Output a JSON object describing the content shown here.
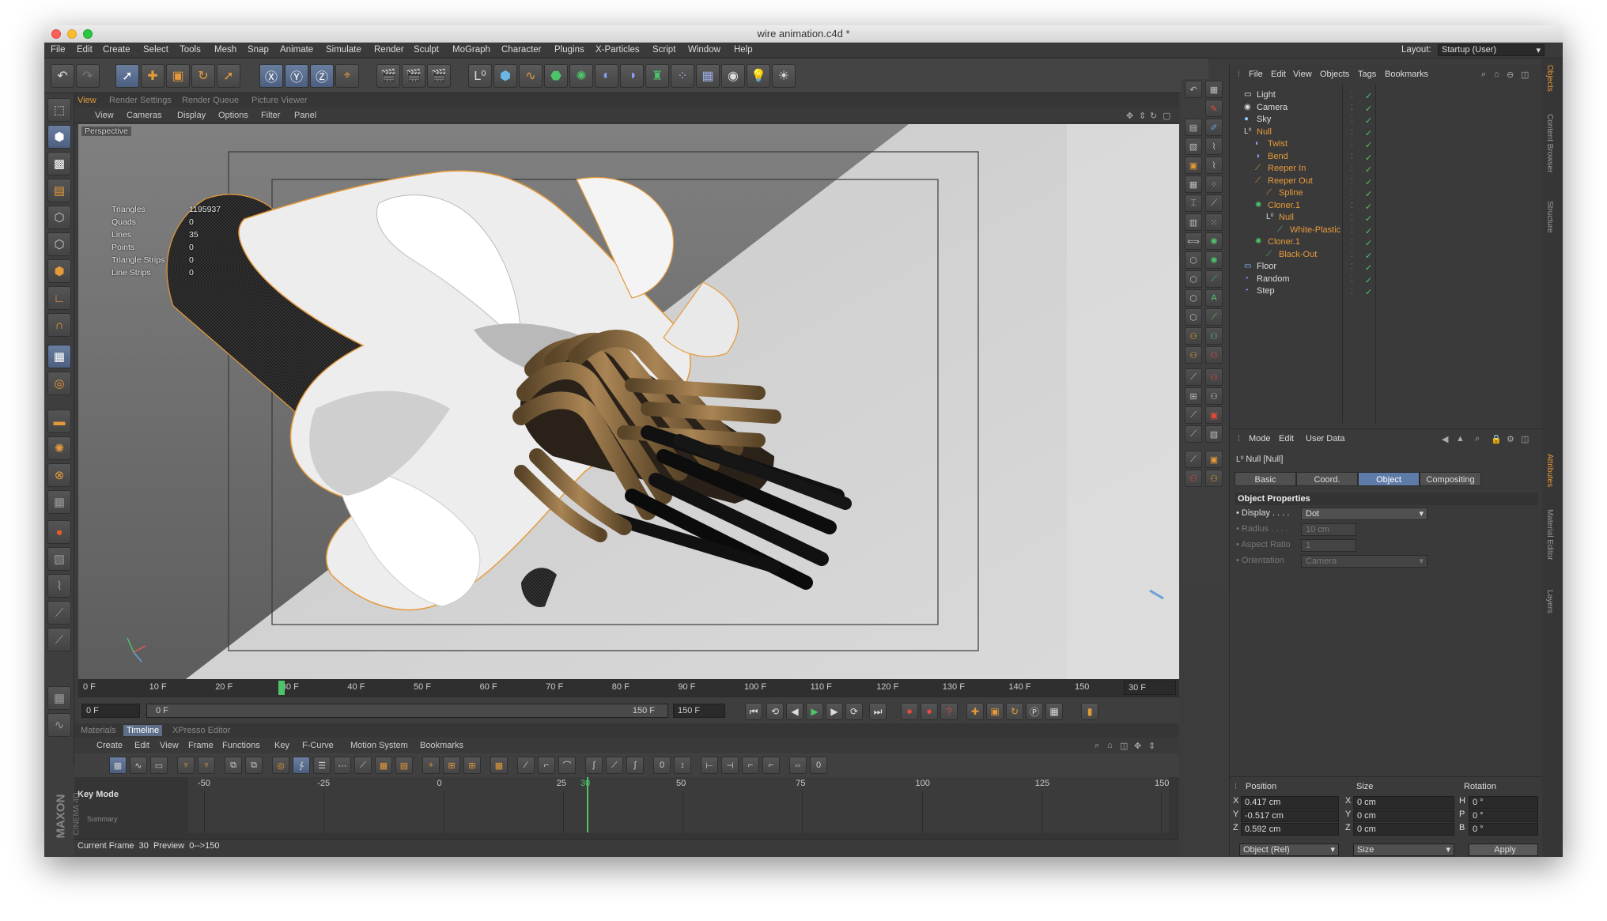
{
  "window": {
    "title": "wire animation.c4d *"
  },
  "menubar": {
    "items": [
      "File",
      "Edit",
      "Create",
      "Select",
      "Tools",
      "Mesh",
      "Snap",
      "Animate",
      "Simulate",
      "Render",
      "Sculpt",
      "MoGraph",
      "Character",
      "Plugins",
      "X-Particles",
      "Script",
      "Window",
      "Help"
    ],
    "layout_label": "Layout:",
    "layout_value": "Startup (User)"
  },
  "viewport": {
    "tabs": [
      "View",
      "Render Settings",
      "Render Queue",
      "Picture Viewer"
    ],
    "menu": [
      "View",
      "Cameras",
      "Display",
      "Options",
      "Filter",
      "Panel"
    ],
    "camera_label": "Perspective",
    "stats": [
      {
        "label": "Triangles",
        "value": "1195937"
      },
      {
        "label": "Quads",
        "value": "0"
      },
      {
        "label": "Lines",
        "value": "35"
      },
      {
        "label": "Points",
        "value": "0"
      },
      {
        "label": "Triangle Strips",
        "value": "0"
      },
      {
        "label": "Line Strips",
        "value": "0"
      }
    ],
    "colors": {
      "selection": "#e59a3a",
      "background": "#6f6f6f"
    }
  },
  "timeline_ruler": {
    "labels": [
      "0 F",
      "10 F",
      "20 F",
      "30 F",
      "40 F",
      "50 F",
      "60 F",
      "70 F",
      "80 F",
      "90 F",
      "100 F",
      "110 F",
      "120 F",
      "130 F",
      "140 F",
      "150"
    ],
    "current_frame_field": "30 F",
    "current_frame_value": 30,
    "max_frame": 150
  },
  "transport": {
    "start_field": "0 F",
    "range_start": "0 F",
    "range_end": "150 F",
    "end_field": "150 F"
  },
  "bottom_tabs": [
    "Materials",
    "Timeline",
    "XPresso Editor"
  ],
  "timeline_menu": [
    "Create",
    "Edit",
    "View",
    "Frame",
    "Functions",
    "Key",
    "F-Curve",
    "Motion System",
    "Bookmarks"
  ],
  "dopesheet": {
    "mode_label": "Key Mode",
    "ruler": [
      "-50",
      "-25",
      "0",
      "25",
      "30",
      "50",
      "75",
      "100",
      "125",
      "150"
    ],
    "partial_row": "Summary"
  },
  "status": {
    "current_frame": "Current Frame  30  Preview  0-->150"
  },
  "brand": {
    "line1": "MAXON",
    "line2": "CINEMA 4D"
  },
  "object_manager": {
    "menu": [
      "File",
      "Edit",
      "View",
      "Objects",
      "Tags",
      "Bookmarks"
    ],
    "objects": [
      {
        "name": "Light",
        "icon": "light-icon",
        "indent": 0,
        "color": "#dddddd"
      },
      {
        "name": "Camera",
        "icon": "camera-icon",
        "indent": 0,
        "color": "#dddddd"
      },
      {
        "name": "Sky",
        "icon": "sky-icon",
        "indent": 0,
        "color": "#dddddd"
      },
      {
        "name": "Null",
        "icon": "null-icon",
        "indent": 0,
        "color": "#e59a3a"
      },
      {
        "name": "Twist",
        "icon": "twist-icon",
        "indent": 1,
        "color": "#e59a3a"
      },
      {
        "name": "Bend",
        "icon": "bend-icon",
        "indent": 1,
        "color": "#e59a3a"
      },
      {
        "name": "Reeper In",
        "icon": "spline-icon",
        "indent": 1,
        "color": "#e59a3a"
      },
      {
        "name": "Reeper Out",
        "icon": "spline-icon",
        "indent": 1,
        "color": "#e59a3a"
      },
      {
        "name": "Spline",
        "icon": "spline-icon",
        "indent": 2,
        "color": "#e59a3a"
      },
      {
        "name": "Cloner.1",
        "icon": "cloner-icon",
        "indent": 1,
        "color": "#e59a3a"
      },
      {
        "name": "Null",
        "icon": "null-icon",
        "indent": 2,
        "color": "#e59a3a"
      },
      {
        "name": "White-Plastic",
        "icon": "tube-icon",
        "indent": 3,
        "color": "#e59a3a"
      },
      {
        "name": "Cloner.1",
        "icon": "cloner-icon",
        "indent": 1,
        "color": "#e59a3a"
      },
      {
        "name": "Black-Out",
        "icon": "tube-icon",
        "indent": 2,
        "color": "#e59a3a"
      },
      {
        "name": "Floor",
        "icon": "floor-icon",
        "indent": 0,
        "color": "#dddddd"
      },
      {
        "name": "Random",
        "icon": "effector-icon",
        "indent": 0,
        "color": "#dddddd"
      },
      {
        "name": "Step",
        "icon": "effector-icon",
        "indent": 0,
        "color": "#dddddd"
      }
    ]
  },
  "attributes": {
    "menu": [
      "Mode",
      "Edit",
      "User Data"
    ],
    "object_title": "Null [Null]",
    "tabs": [
      "Basic",
      "Coord.",
      "Object",
      "Compositing"
    ],
    "active_tab": "Object",
    "section": "Object Properties",
    "props": [
      {
        "label": "Display . . . .",
        "value": "Dot",
        "dim": false
      },
      {
        "label": "Radius . . . .",
        "value": "10 cm",
        "dim": true
      },
      {
        "label": "Aspect Ratio",
        "value": "1",
        "dim": true
      },
      {
        "label": "Orientation",
        "value": "Camera",
        "dim": true
      }
    ]
  },
  "coordinates": {
    "headers": [
      "Position",
      "Size",
      "Rotation"
    ],
    "rows": [
      {
        "axis": "X",
        "pos": "0.417 cm",
        "size": "0 cm",
        "rot_axis": "H",
        "rot": "0 °"
      },
      {
        "axis": "Y",
        "pos": "-0.517 cm",
        "size": "0 cm",
        "rot_axis": "P",
        "rot": "0 °"
      },
      {
        "axis": "Z",
        "pos": "0.592 cm",
        "size": "0 cm",
        "rot_axis": "B",
        "rot": "0 °"
      }
    ],
    "mode": "Object (Rel)",
    "size_mode": "Size",
    "apply": "Apply"
  },
  "side_tabs": {
    "top": [
      "Objects",
      "Content Browser",
      "Structure"
    ],
    "bottom": [
      "Attributes",
      "Material Editor",
      "Layers"
    ]
  }
}
